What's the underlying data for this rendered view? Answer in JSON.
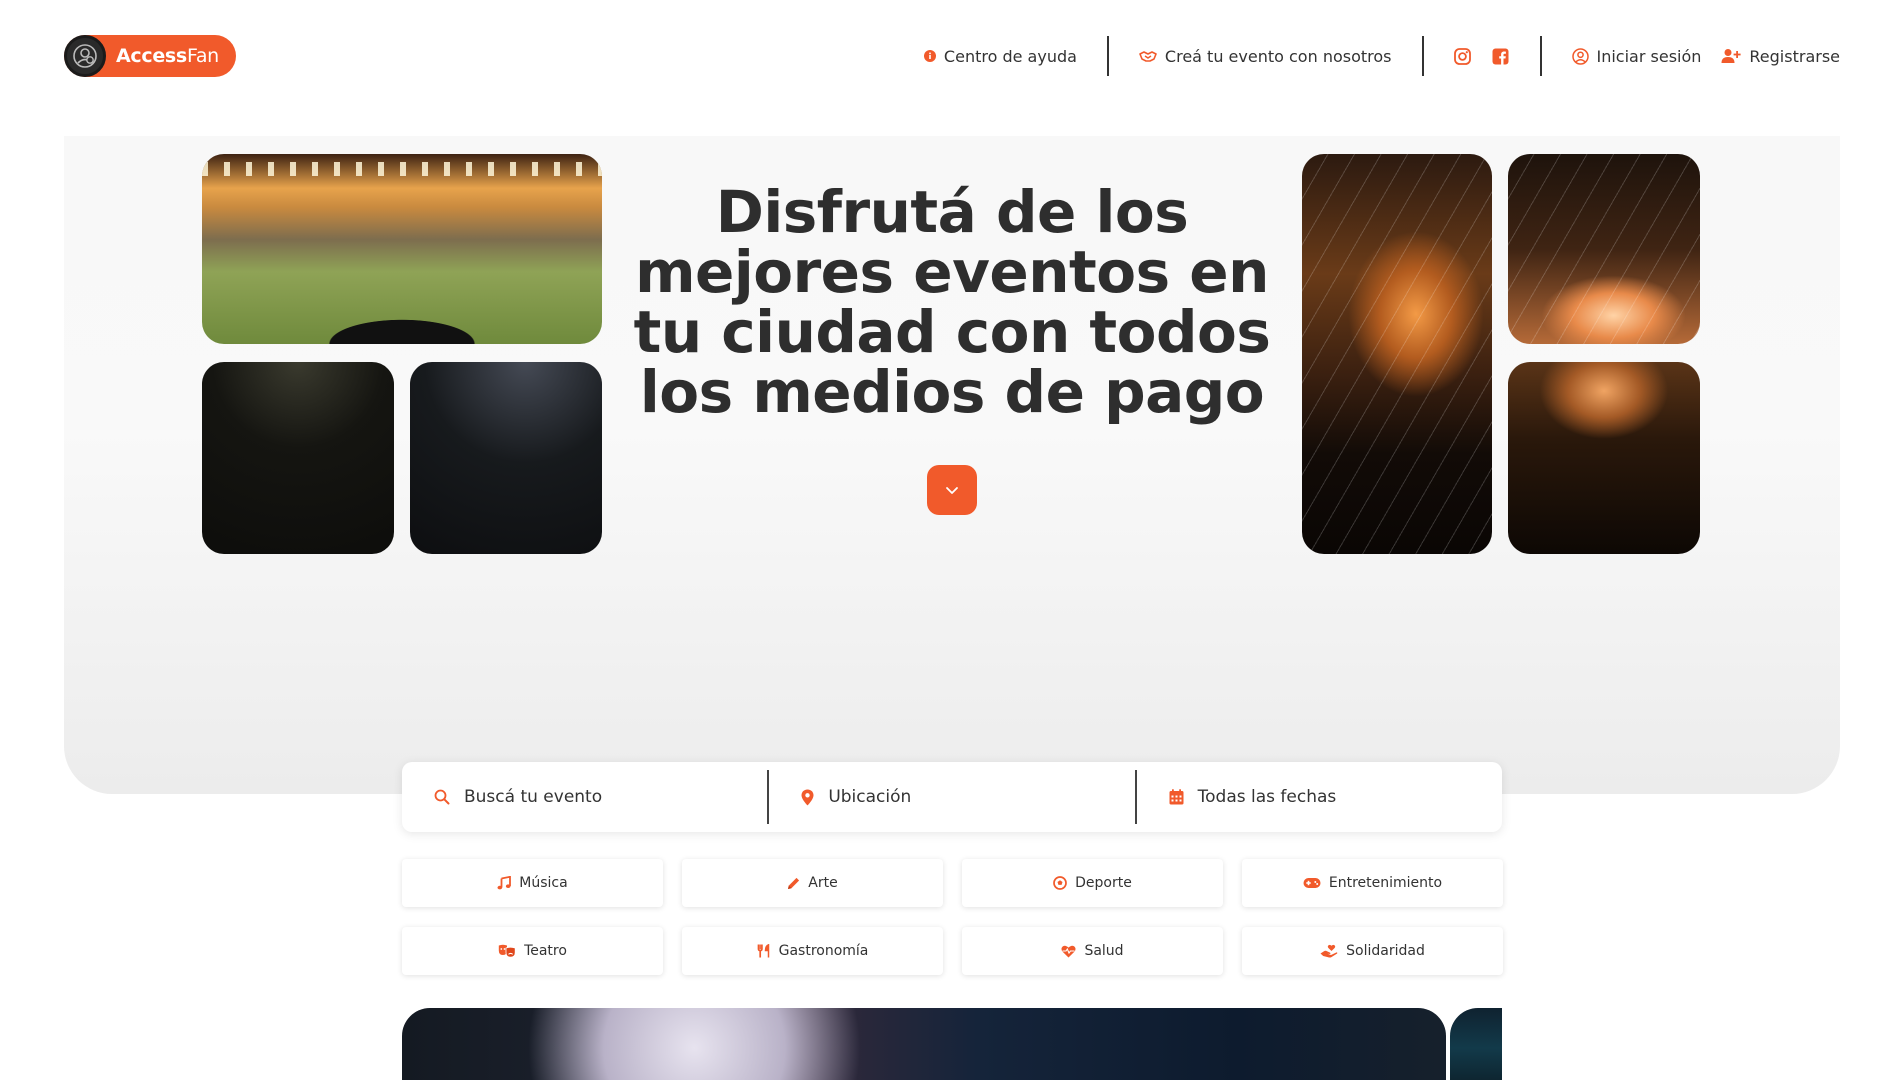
{
  "brand": {
    "name_bold": "Access",
    "name_light": "Fan"
  },
  "nav": {
    "help": "Centro de ayuda",
    "create_event": "Creá tu evento con nosotros",
    "login": "Iniciar sesión",
    "register": "Registrarse"
  },
  "hero": {
    "title": "Disfrutá de los mejores eventos en tu ciudad con todos los medios de pago"
  },
  "search": {
    "event_placeholder": "Buscá tu evento",
    "location_placeholder": "Ubicación",
    "dates_label": "Todas las fechas"
  },
  "categories": [
    {
      "label": "Música",
      "icon": "music-note-icon"
    },
    {
      "label": "Arte",
      "icon": "pencil-icon"
    },
    {
      "label": "Deporte",
      "icon": "soccer-ball-icon"
    },
    {
      "label": "Entretenimiento",
      "icon": "gamepad-icon"
    },
    {
      "label": "Teatro",
      "icon": "theater-masks-icon"
    },
    {
      "label": "Gastronomía",
      "icon": "utensils-icon"
    },
    {
      "label": "Salud",
      "icon": "heart-pulse-icon"
    },
    {
      "label": "Solidaridad",
      "icon": "hand-heart-icon"
    }
  ],
  "colors": {
    "accent": "#f15a2b",
    "text": "#2e2e2e",
    "hero_bg": "#f2f2f2"
  }
}
